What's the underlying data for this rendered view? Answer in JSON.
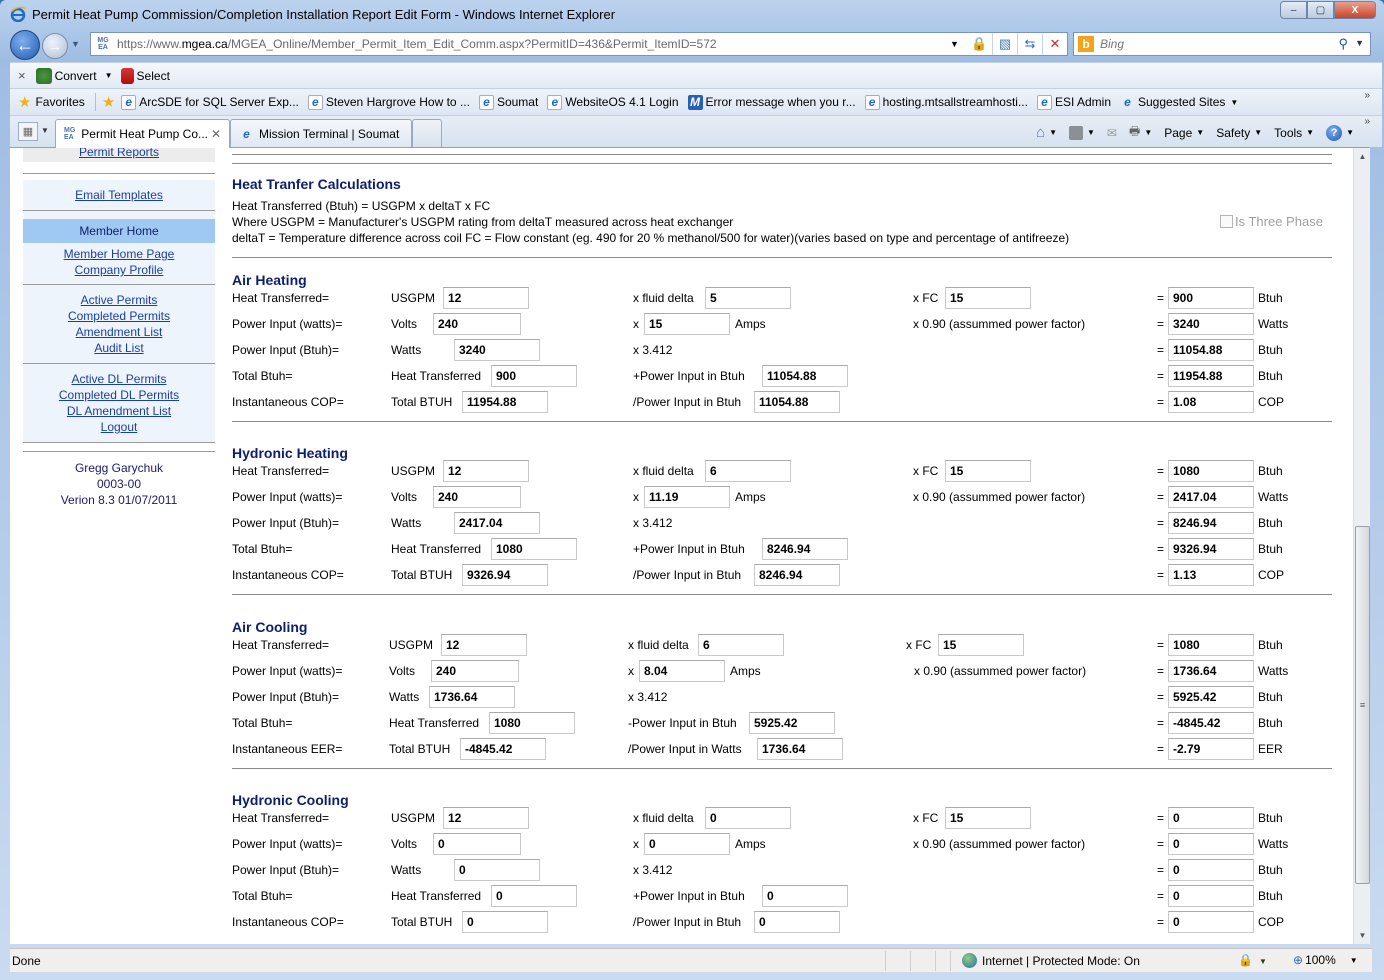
{
  "window": {
    "title": "Permit Heat Pump Commission/Completion Installation Report Edit Form - Windows Internet Explorer",
    "minimize": "–",
    "maximize": "▢",
    "close": "X"
  },
  "navigation": {
    "back": "←",
    "forward": "→",
    "address_prefix": "https://www.",
    "address_host": "mgea.ca",
    "address_path": "/MGEA_Online/Member_Permit_Item_Edit_Comm.aspx?PermitID=436&Permit_ItemID=572",
    "search_placeholder": "Bing"
  },
  "command_bar": {
    "close": "×",
    "convert_label": "Convert",
    "select_label": "Select"
  },
  "favorites_bar": {
    "favorites_label": "Favorites",
    "items": [
      {
        "label": "ArcSDE for SQL Server Exp...",
        "icon": "ie-page-icon"
      },
      {
        "label": "Steven Hargrove  How to ...",
        "icon": "ie-page-icon"
      },
      {
        "label": "Soumat",
        "icon": "ie-page-icon"
      },
      {
        "label": "WebsiteOS 4.1 Login",
        "icon": "ie-page-icon"
      },
      {
        "label": "Error message when you r...",
        "icon": "msdn-icon"
      },
      {
        "label": "hosting.mtsallstreamhosti...",
        "icon": "ie-page-icon"
      },
      {
        "label": "ESI Admin",
        "icon": "ie-page-icon"
      },
      {
        "label": "Suggested Sites",
        "icon": "ie-icon"
      }
    ]
  },
  "tabs": [
    {
      "label": "Permit Heat Pump Co...",
      "active": true
    },
    {
      "label": "Mission Terminal | Soumat",
      "active": false
    }
  ],
  "toolbar": {
    "page": "Page",
    "safety": "Safety",
    "tools": "Tools",
    "help": "?"
  },
  "sidebar": {
    "permit_reports": "Permit Reports",
    "email_templates": "Email Templates",
    "member_home_header": "Member Home",
    "group1": [
      "Member Home Page",
      "Company Profile"
    ],
    "group2": [
      "Active Permits",
      "Completed Permits",
      "Amendment List",
      "Audit List"
    ],
    "group3": [
      "Active DL Permits",
      "Completed DL Permits",
      "DL Amendment List",
      "Logout"
    ],
    "user_name": "Gregg Garychuk",
    "user_code": "0003-00",
    "version": "Verion 8.3 01/07/2011"
  },
  "intro": {
    "title": "Heat Tranfer Calculations",
    "line1": "Heat Transferred (Btuh) = USGPM x deltaT x FC",
    "line2": "Where USGPM = Manufacturer's USGPM rating from deltaT measured across heat exchanger",
    "line3": "deltaT = Temperature difference across coil FC = Flow constant (eg. 490 for 20 % methanol/500 for water)(varies based on type and percentage of antifreeze)",
    "three_phase_label": "Is Three Phase",
    "three_phase_checked": false
  },
  "sections": [
    {
      "title": "Air Heating",
      "rows": [
        {
          "label": "Heat Transferred=",
          "a_label": "USGPM",
          "a": "12",
          "b_label": "x fluid delta",
          "b": "5",
          "c_label": "x FC",
          "c": "15",
          "eq": "=",
          "result": "900",
          "unit": "Btuh"
        },
        {
          "label": "Power Input (watts)=",
          "a_label": "Volts",
          "a": "240",
          "b_label": "x",
          "b": "15",
          "b_unit": "Amps",
          "c_label": "x 0.90 (assummed power factor)",
          "eq": "=",
          "result": "3240",
          "unit": "Watts"
        },
        {
          "label": "Power Input (Btuh)=",
          "a_label": "Watts",
          "a": "3240",
          "b_label": "x 3.412",
          "eq": "=",
          "result": "11054.88",
          "unit": "Btuh"
        },
        {
          "label": "Total Btuh=",
          "a_label": "Heat Transferred",
          "a": "900",
          "b_label": "+Power Input in Btuh",
          "b": "11054.88",
          "eq": "=",
          "result": "11954.88",
          "unit": "Btuh"
        },
        {
          "label": "Instantaneous COP=",
          "a_label": "Total BTUH",
          "a": "11954.88",
          "b_label": "/Power Input in Btuh",
          "b": "11054.88",
          "eq": "=",
          "result": "1.08",
          "unit": "COP"
        }
      ]
    },
    {
      "title": "Hydronic Heating",
      "rows": [
        {
          "label": "Heat Transferred=",
          "a_label": "USGPM",
          "a": "12",
          "b_label": "x fluid delta",
          "b": "6",
          "c_label": "x FC",
          "c": "15",
          "eq": "=",
          "result": "1080",
          "unit": "Btuh"
        },
        {
          "label": "Power Input (watts)=",
          "a_label": "Volts",
          "a": "240",
          "b_label": "x",
          "b": "11.19",
          "b_unit": "Amps",
          "c_label": "x 0.90 (assummed power factor)",
          "eq": "=",
          "result": "2417.04",
          "unit": "Watts"
        },
        {
          "label": "Power Input (Btuh)=",
          "a_label": "Watts",
          "a": "2417.04",
          "b_label": "x 3.412",
          "eq": "=",
          "result": "8246.94",
          "unit": "Btuh"
        },
        {
          "label": "Total Btuh=",
          "a_label": "Heat Transferred",
          "a": "1080",
          "b_label": "+Power Input in Btuh",
          "b": "8246.94",
          "eq": "=",
          "result": "9326.94",
          "unit": "Btuh"
        },
        {
          "label": "Instantaneous COP=",
          "a_label": "Total BTUH",
          "a": "9326.94",
          "b_label": "/Power Input in Btuh",
          "b": "8246.94",
          "eq": "=",
          "result": "1.13",
          "unit": "COP"
        }
      ]
    },
    {
      "title": "Air Cooling",
      "rows": [
        {
          "label": "Heat Transferred=",
          "a_label": "USGPM",
          "a": "12",
          "b_label": "x fluid delta",
          "b": "6",
          "c_label": "x FC",
          "c": "15",
          "eq": "=",
          "result": "1080",
          "unit": "Btuh"
        },
        {
          "label": "Power Input (watts)=",
          "a_label": "Volts",
          "a": "240",
          "b_label": "x",
          "b": "8.04",
          "b_unit": "Amps",
          "c_label": "x 0.90 (assummed power factor)",
          "eq": "=",
          "result": "1736.64",
          "unit": "Watts"
        },
        {
          "label": "Power Input (Btuh)=",
          "a_label": "Watts",
          "a": "1736.64",
          "b_label": "x 3.412",
          "eq": "=",
          "result": "5925.42",
          "unit": "Btuh"
        },
        {
          "label": "Total Btuh=",
          "a_label": "Heat Transferred",
          "a": "1080",
          "b_label": "-Power Input in Btuh",
          "b": "5925.42",
          "eq": "=",
          "result": "-4845.42",
          "unit": "Btuh"
        },
        {
          "label": "Instantaneous EER=",
          "a_label": "Total BTUH",
          "a": "-4845.42",
          "b_label": "/Power Input in Watts",
          "b": "1736.64",
          "eq": "=",
          "result": "-2.79",
          "unit": "EER"
        }
      ]
    },
    {
      "title": "Hydronic Cooling",
      "rows": [
        {
          "label": "Heat Transferred=",
          "a_label": "USGPM",
          "a": "12",
          "b_label": "x fluid delta",
          "b": "0",
          "c_label": "x FC",
          "c": "15",
          "eq": "=",
          "result": "0",
          "unit": "Btuh"
        },
        {
          "label": "Power Input (watts)=",
          "a_label": "Volts",
          "a": "0",
          "b_label": "x",
          "b": "0",
          "b_unit": "Amps",
          "c_label": "x 0.90 (assummed power factor)",
          "eq": "=",
          "result": "0",
          "unit": "Watts"
        },
        {
          "label": "Power Input (Btuh)=",
          "a_label": "Watts",
          "a": "0",
          "b_label": "x 3.412",
          "eq": "=",
          "result": "0",
          "unit": "Btuh"
        },
        {
          "label": "Total Btuh=",
          "a_label": "Heat Transferred",
          "a": "0",
          "b_label": "+Power Input in Btuh",
          "b": "0",
          "eq": "=",
          "result": "0",
          "unit": "Btuh"
        },
        {
          "label": "Instantaneous COP=",
          "a_label": "Total BTUH",
          "a": "0",
          "b_label": "/Power Input in Btuh",
          "b": "0",
          "eq": "=",
          "result": "0",
          "unit": "COP"
        }
      ]
    }
  ],
  "status_bar": {
    "status": "Done",
    "zone": "Internet | Protected Mode: On",
    "zoom": "100%"
  }
}
